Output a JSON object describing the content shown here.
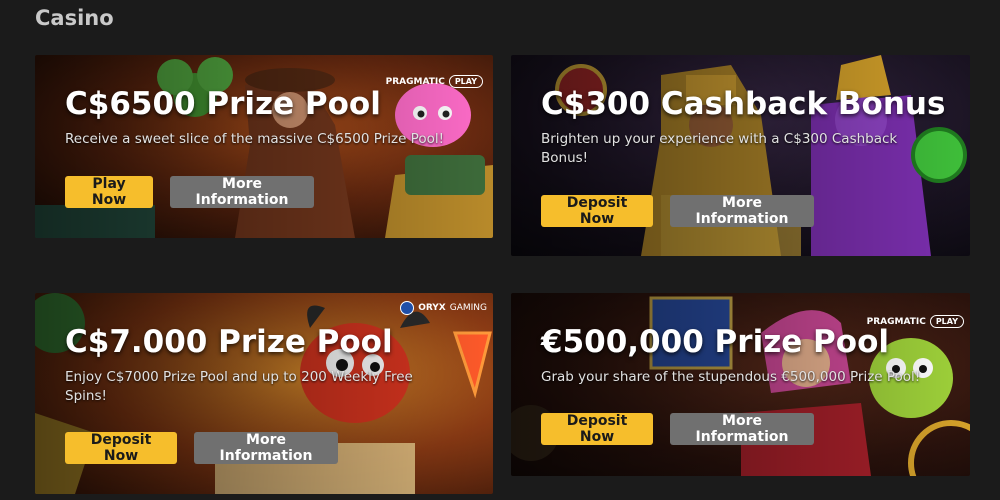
{
  "section": {
    "title": "Casino"
  },
  "promos": [
    {
      "title": "C$6500 Prize Pool",
      "description": "Receive a sweet slice of the massive C$6500 Prize Pool!",
      "primary_label": "Play Now",
      "secondary_label": "More Information",
      "provider_main": "PRAGMATIC",
      "provider_pill": "PLAY"
    },
    {
      "title": "C$300 Cashback Bonus",
      "description": "Brighten up your experience with a C$300 Cashback Bonus!",
      "primary_label": "Deposit Now",
      "secondary_label": "More Information"
    },
    {
      "title": "C$7.000 Prize Pool",
      "description": "Enjoy C$7000 Prize Pool and up to 200 Weekly Free Spins!",
      "primary_label": "Deposit Now",
      "secondary_label": "More Information",
      "provider_main": "ORYX",
      "provider_sub": "GAMING"
    },
    {
      "title": "€500,000 Prize Pool",
      "description": "Grab your share of the stupendous €500,000 Prize Pool!",
      "primary_label": "Deposit Now",
      "secondary_label": "More Information",
      "provider_main": "PRAGMATIC",
      "provider_pill": "PLAY"
    }
  ],
  "colors": {
    "page_bg": "#1b1b1b",
    "primary_button": "#f6be2c",
    "secondary_button": "#707070"
  }
}
